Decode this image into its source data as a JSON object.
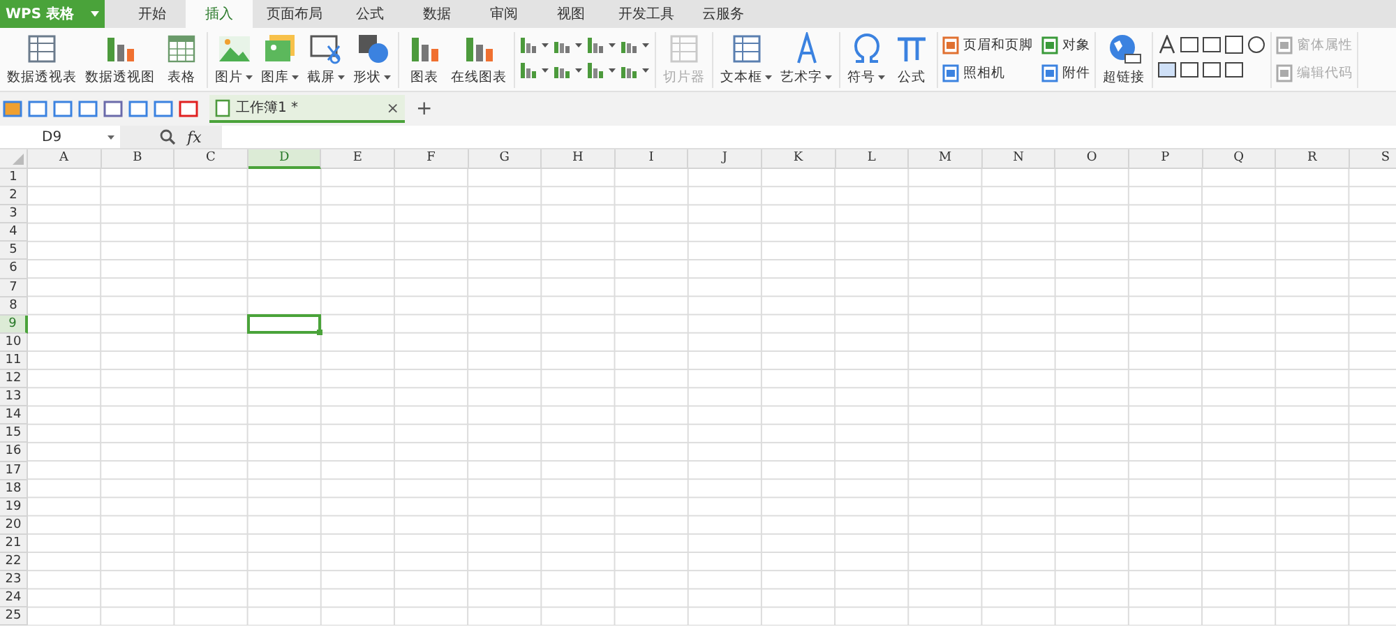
{
  "app_menu": {
    "label": "WPS 表格"
  },
  "tabs": [
    {
      "label": "开始",
      "selected": false
    },
    {
      "label": "插入",
      "selected": true
    },
    {
      "label": "页面布局",
      "selected": false
    },
    {
      "label": "公式",
      "selected": false
    },
    {
      "label": "数据",
      "selected": false
    },
    {
      "label": "审阅",
      "selected": false
    },
    {
      "label": "视图",
      "selected": false
    },
    {
      "label": "开发工具",
      "selected": false
    },
    {
      "label": "云服务",
      "selected": false
    }
  ],
  "ribbon": [
    {
      "kind": "large",
      "items": [
        {
          "label": "数据透视表",
          "dropdown": false,
          "disabled": false
        },
        {
          "label": "数据透视图",
          "dropdown": false,
          "disabled": false
        },
        {
          "label": "表格",
          "dropdown": false,
          "disabled": false
        }
      ]
    },
    {
      "kind": "large",
      "items": [
        {
          "label": "图片",
          "dropdown": true,
          "disabled": false
        },
        {
          "label": "图库",
          "dropdown": true,
          "disabled": false
        },
        {
          "label": "截屏",
          "dropdown": true,
          "disabled": false
        },
        {
          "label": "形状",
          "dropdown": true,
          "disabled": false
        }
      ]
    },
    {
      "kind": "large",
      "items": [
        {
          "label": "图表",
          "dropdown": false,
          "disabled": false
        },
        {
          "label": "在线图表",
          "dropdown": false,
          "disabled": false
        }
      ]
    },
    {
      "kind": "chart-grid"
    },
    {
      "kind": "large",
      "items": [
        {
          "label": "切片器",
          "dropdown": false,
          "disabled": true
        }
      ]
    },
    {
      "kind": "large",
      "items": [
        {
          "label": "文本框",
          "dropdown": true,
          "disabled": false
        },
        {
          "label": "艺术字",
          "dropdown": true,
          "disabled": false
        }
      ]
    },
    {
      "kind": "large",
      "items": [
        {
          "label": "符号",
          "dropdown": true,
          "disabled": false
        },
        {
          "label": "公式",
          "dropdown": false,
          "disabled": false
        }
      ]
    },
    {
      "kind": "small",
      "items": [
        {
          "label": "页眉和页脚",
          "disabled": false
        },
        {
          "label": "照相机",
          "disabled": false
        },
        {
          "label": "对象",
          "disabled": false
        },
        {
          "label": "附件",
          "disabled": false
        }
      ]
    },
    {
      "kind": "large",
      "items": [
        {
          "label": "超链接",
          "dropdown": false,
          "disabled": false
        }
      ]
    },
    {
      "kind": "controls"
    },
    {
      "kind": "small",
      "items": [
        {
          "label": "窗体属性",
          "disabled": true
        },
        {
          "label": "编辑代码",
          "disabled": true
        }
      ]
    }
  ],
  "document_tab": {
    "title": "工作簿1 *",
    "close": "×",
    "new": "+"
  },
  "name_box": {
    "value": "D9"
  },
  "formula_bar": {
    "fx": "fx"
  },
  "columns": [
    {
      "label": "A",
      "selected": false
    },
    {
      "label": "B",
      "selected": false
    },
    {
      "label": "C",
      "selected": false
    },
    {
      "label": "D",
      "selected": true
    },
    {
      "label": "E",
      "selected": false
    },
    {
      "label": "F",
      "selected": false
    },
    {
      "label": "G",
      "selected": false
    },
    {
      "label": "H",
      "selected": false
    },
    {
      "label": "I",
      "selected": false
    },
    {
      "label": "J",
      "selected": false
    },
    {
      "label": "K",
      "selected": false
    },
    {
      "label": "L",
      "selected": false
    },
    {
      "label": "M",
      "selected": false
    },
    {
      "label": "N",
      "selected": false
    },
    {
      "label": "O",
      "selected": false
    },
    {
      "label": "P",
      "selected": false
    },
    {
      "label": "Q",
      "selected": false
    },
    {
      "label": "R",
      "selected": false
    },
    {
      "label": "S",
      "selected": false
    }
  ],
  "rows": [
    {
      "label": "1",
      "selected": false
    },
    {
      "label": "2",
      "selected": false
    },
    {
      "label": "3",
      "selected": false
    },
    {
      "label": "4",
      "selected": false
    },
    {
      "label": "5",
      "selected": false
    },
    {
      "label": "6",
      "selected": false
    },
    {
      "label": "7",
      "selected": false
    },
    {
      "label": "8",
      "selected": false
    },
    {
      "label": "9",
      "selected": true
    },
    {
      "label": "10",
      "selected": false
    },
    {
      "label": "11",
      "selected": false
    },
    {
      "label": "12",
      "selected": false
    },
    {
      "label": "13",
      "selected": false
    },
    {
      "label": "14",
      "selected": false
    },
    {
      "label": "15",
      "selected": false
    },
    {
      "label": "16",
      "selected": false
    },
    {
      "label": "17",
      "selected": false
    },
    {
      "label": "18",
      "selected": false
    },
    {
      "label": "19",
      "selected": false
    },
    {
      "label": "20",
      "selected": false
    },
    {
      "label": "21",
      "selected": false
    },
    {
      "label": "22",
      "selected": false
    },
    {
      "label": "23",
      "selected": false
    },
    {
      "label": "24",
      "selected": false
    },
    {
      "label": "25",
      "selected": false
    }
  ]
}
